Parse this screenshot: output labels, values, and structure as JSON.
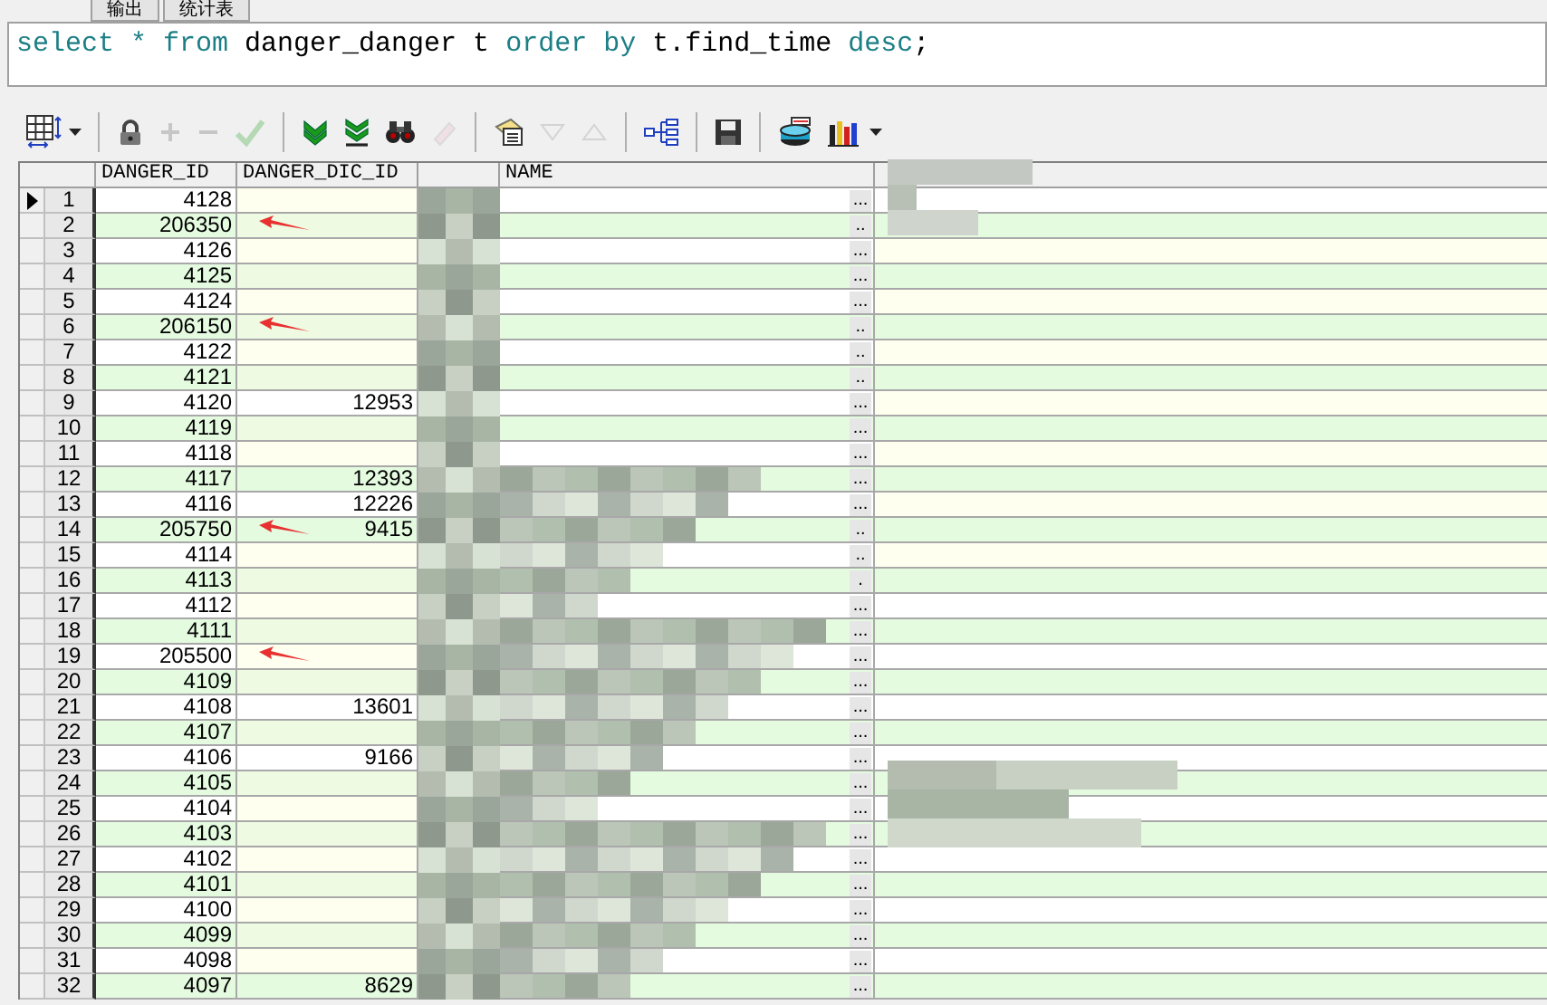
{
  "tabs": [
    {
      "label": "输出",
      "selected": false
    },
    {
      "label": "统计表",
      "selected": false
    }
  ],
  "sql": [
    {
      "text": "select * from",
      "kind": "keyword"
    },
    {
      "text": " danger_danger t "
    },
    {
      "text": "order by",
      "kind": "keyword"
    },
    {
      "text": " t.find_time "
    },
    {
      "text": "desc",
      "kind": "keyword"
    },
    {
      "text": ";"
    }
  ],
  "toolbar": [
    {
      "kind": "grid",
      "disabled": false
    },
    {
      "kind": "lock",
      "disabled": false
    },
    {
      "kind": "plus",
      "disabled": true
    },
    {
      "kind": "minus",
      "disabled": true
    },
    {
      "kind": "check",
      "disabled": true
    },
    {
      "kind": "fetch-next",
      "disabled": false
    },
    {
      "kind": "fetch-last",
      "disabled": false
    },
    {
      "kind": "find",
      "disabled": false
    },
    {
      "kind": "clear",
      "disabled": true
    },
    {
      "kind": "query",
      "disabled": false
    },
    {
      "kind": "down",
      "disabled": true
    },
    {
      "kind": "up",
      "disabled": true
    },
    {
      "kind": "tree",
      "disabled": false
    },
    {
      "kind": "save",
      "disabled": false
    },
    {
      "kind": "export",
      "disabled": false
    },
    {
      "kind": "chart",
      "disabled": false
    }
  ],
  "columns": [
    {
      "kind": "text",
      "label": "DANGER_ID"
    },
    {
      "kind": "text",
      "label": "DANGER_DIC_ID"
    },
    {
      "kind": "hidden"
    },
    {
      "kind": "text",
      "label": "NAME"
    },
    {
      "kind": "blank"
    }
  ],
  "rows": [
    {
      "num": "1",
      "danger_id": "4128",
      "selected": true,
      "flagged": false,
      "ellipsis": "..."
    },
    {
      "num": "2",
      "danger_id": "206350",
      "selected": false,
      "flagged": true,
      "ellipsis": ".."
    },
    {
      "num": "3",
      "danger_id": "4126",
      "selected": false,
      "flagged": false,
      "ellipsis": "..."
    },
    {
      "num": "4",
      "danger_id": "4125",
      "selected": false,
      "flagged": false,
      "ellipsis": "..."
    },
    {
      "num": "5",
      "danger_id": "4124",
      "selected": false,
      "flagged": false,
      "ellipsis": "..."
    },
    {
      "num": "6",
      "danger_id": "206150",
      "selected": false,
      "flagged": true,
      "ellipsis": ".."
    },
    {
      "num": "7",
      "danger_id": "4122",
      "selected": false,
      "flagged": false,
      "ellipsis": ".."
    },
    {
      "num": "8",
      "danger_id": "4121",
      "selected": false,
      "flagged": false,
      "ellipsis": ".."
    },
    {
      "num": "9",
      "danger_id": "4120",
      "danger_dic_id": "12953",
      "selected": false,
      "flagged": false,
      "ellipsis": "..."
    },
    {
      "num": "10",
      "danger_id": "4119",
      "selected": false,
      "flagged": false,
      "ellipsis": "..."
    },
    {
      "num": "11",
      "danger_id": "4118",
      "selected": false,
      "flagged": false,
      "ellipsis": "..."
    },
    {
      "num": "12",
      "danger_id": "4117",
      "danger_dic_id": "12393",
      "selected": false,
      "flagged": false,
      "ellipsis": "..."
    },
    {
      "num": "13",
      "danger_id": "4116",
      "danger_dic_id": "12226",
      "selected": false,
      "flagged": false,
      "ellipsis": "..."
    },
    {
      "num": "14",
      "danger_id": "205750",
      "danger_dic_id": "9415",
      "selected": false,
      "flagged": true,
      "ellipsis": ".."
    },
    {
      "num": "15",
      "danger_id": "4114",
      "selected": false,
      "flagged": false,
      "ellipsis": ".."
    },
    {
      "num": "16",
      "danger_id": "4113",
      "selected": false,
      "flagged": false,
      "ellipsis": "."
    },
    {
      "num": "17",
      "danger_id": "4112",
      "selected": false,
      "flagged": false,
      "ellipsis": "..."
    },
    {
      "num": "18",
      "danger_id": "4111",
      "selected": false,
      "flagged": false,
      "ellipsis": "..."
    },
    {
      "num": "19",
      "danger_id": "205500",
      "selected": false,
      "flagged": true,
      "ellipsis": "..."
    },
    {
      "num": "20",
      "danger_id": "4109",
      "selected": false,
      "flagged": false,
      "ellipsis": "..."
    },
    {
      "num": "21",
      "danger_id": "4108",
      "danger_dic_id": "13601",
      "selected": false,
      "flagged": false,
      "ellipsis": "..."
    },
    {
      "num": "22",
      "danger_id": "4107",
      "selected": false,
      "flagged": false,
      "ellipsis": "..."
    },
    {
      "num": "23",
      "danger_id": "4106",
      "danger_dic_id": "9166",
      "selected": false,
      "flagged": false,
      "ellipsis": "..."
    },
    {
      "num": "24",
      "danger_id": "4105",
      "selected": false,
      "flagged": false,
      "ellipsis": "..."
    },
    {
      "num": "25",
      "danger_id": "4104",
      "selected": false,
      "flagged": false,
      "ellipsis": "..."
    },
    {
      "num": "26",
      "danger_id": "4103",
      "selected": false,
      "flagged": false,
      "ellipsis": "..."
    },
    {
      "num": "27",
      "danger_id": "4102",
      "selected": false,
      "flagged": false,
      "ellipsis": "..."
    },
    {
      "num": "28",
      "danger_id": "4101",
      "selected": false,
      "flagged": false,
      "ellipsis": "..."
    },
    {
      "num": "29",
      "danger_id": "4100",
      "selected": false,
      "flagged": false,
      "ellipsis": "..."
    },
    {
      "num": "30",
      "danger_id": "4099",
      "selected": false,
      "flagged": false,
      "ellipsis": "..."
    },
    {
      "num": "31",
      "danger_id": "4098",
      "selected": false,
      "flagged": false,
      "ellipsis": "..."
    },
    {
      "num": "32",
      "danger_id": "4097",
      "danger_dic_id": "8629",
      "selected": false,
      "flagged": false,
      "ellipsis": "..."
    }
  ]
}
